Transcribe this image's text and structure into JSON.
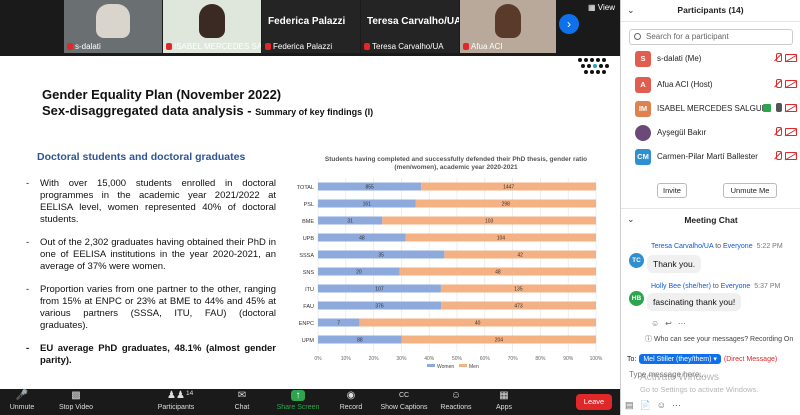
{
  "video_tiles": [
    {
      "name": "s-dalati",
      "muted": true,
      "type": "video"
    },
    {
      "name": "ISABEL MERCEDES SALGU...",
      "muted": true,
      "type": "video"
    },
    {
      "name": "Federica Palazzi",
      "muted": true,
      "type": "name-only"
    },
    {
      "name": "Teresa Carvalho/UA",
      "muted": true,
      "type": "name-only"
    },
    {
      "name": "Afua ACI",
      "muted": true,
      "type": "video"
    }
  ],
  "view_label": "View",
  "slide": {
    "heading_line1": "Gender Equality Plan (November 2022)",
    "heading_line2": "Sex-disaggregated data analysis -",
    "heading_sub": "Summary of key findings (I)",
    "section_title": "Doctoral students and doctoral graduates",
    "bullets": [
      "With over 15,000 students enrolled in doctoral programmes in the academic year 2021/2022 at EELISA level, women represented 40% of doctoral students.",
      "Out of the 2,302 graduates having obtained their PhD in one of EELISA institutions in the year 2020-2021, an average of 37% were women.",
      "Proportion varies from one partner to the other, ranging from 15% at ENPC or 23% at BME to 44% and 45% at various partners (SSSA, ITU, FAU) (doctoral graduates).",
      "EU average PhD graduates, 48.1% (almost gender parity)."
    ]
  },
  "chart_data": {
    "type": "bar",
    "orientation": "horizontal-stacked-100",
    "title": "Students having completed and successfully defended their PhD thesis, gender ratio (men/women), academic year 2020-2021",
    "categories": [
      "TOTAL",
      "PSL",
      "BME",
      "UPB",
      "SSSA",
      "SNS",
      "ITU",
      "FAU",
      "ENPC",
      "UPM"
    ],
    "series": [
      {
        "name": "Women",
        "color": "#8ea9db",
        "values": [
          855,
          161,
          31,
          48,
          35,
          20,
          107,
          376,
          7,
          88
        ]
      },
      {
        "name": "Men",
        "color": "#f4b183",
        "values": [
          1447,
          298,
          103,
          104,
          42,
          48,
          135,
          473,
          40,
          204
        ]
      }
    ],
    "xticks": [
      "0%",
      "10%",
      "20%",
      "30%",
      "40%",
      "50%",
      "60%",
      "70%",
      "80%",
      "90%",
      "100%"
    ],
    "xlim": [
      0,
      100
    ],
    "grid": true,
    "legend": "bottom"
  },
  "panel": {
    "title": "Participants (14)",
    "search_placeholder": "Search for a participant",
    "participants": [
      {
        "initials": "S",
        "name": "s-dalati (Me)",
        "color": "#e05d4f",
        "mic": "off",
        "cam": "off"
      },
      {
        "initials": "A",
        "name": "Afua ACI (Host)",
        "color": "#e05d4f",
        "mic": "off",
        "cam": "off"
      },
      {
        "initials": "IM",
        "name": "ISABEL MERCEDES SALGUE...",
        "color": "#e0824f",
        "mic": "on",
        "cam": "off"
      },
      {
        "initials": "",
        "name": "Ayşegül Bakır",
        "color": "#6b4a7a",
        "mic": "off",
        "cam": "off"
      },
      {
        "initials": "CM",
        "name": "Carmen-Pilar Martí Ballester",
        "color": "#2f8fd0",
        "mic": "off",
        "cam": "off"
      }
    ],
    "invite_label": "Invite",
    "unmute_me_label": "Unmute Me"
  },
  "chat": {
    "title": "Meeting Chat",
    "messages": [
      {
        "initials": "TC",
        "sender": "Teresa Carvalho/UA",
        "to_label": "to",
        "recipient": "Everyone",
        "time": "5:22 PM",
        "text": "Thank you.",
        "color": "#2f8fd0"
      },
      {
        "initials": "HB",
        "sender": "Holly Bee (she/her)",
        "to_label": "to",
        "recipient": "Everyone",
        "time": "5:37 PM",
        "text": "fascinating thank you!",
        "color": "#2da44e"
      }
    ],
    "hint": "Who can see your messages? Recording On",
    "to_prefix": "To:",
    "to_recipient": "Mel Stiller (they/them)",
    "to_note": "(Direct Message)",
    "input_placeholder": "Type message here..."
  },
  "watermark": {
    "line1": "Activate Windows",
    "line2": "Go to Settings to activate Windows."
  },
  "toolbar": {
    "unmute": "Unmute",
    "stop_video": "Stop Video",
    "participants": "Participants",
    "participants_count": "14",
    "chat": "Chat",
    "share_screen": "Share Screen",
    "record": "Record",
    "show_captions": "Show Captions",
    "reactions": "Reactions",
    "apps": "Apps",
    "leave": "Leave"
  }
}
